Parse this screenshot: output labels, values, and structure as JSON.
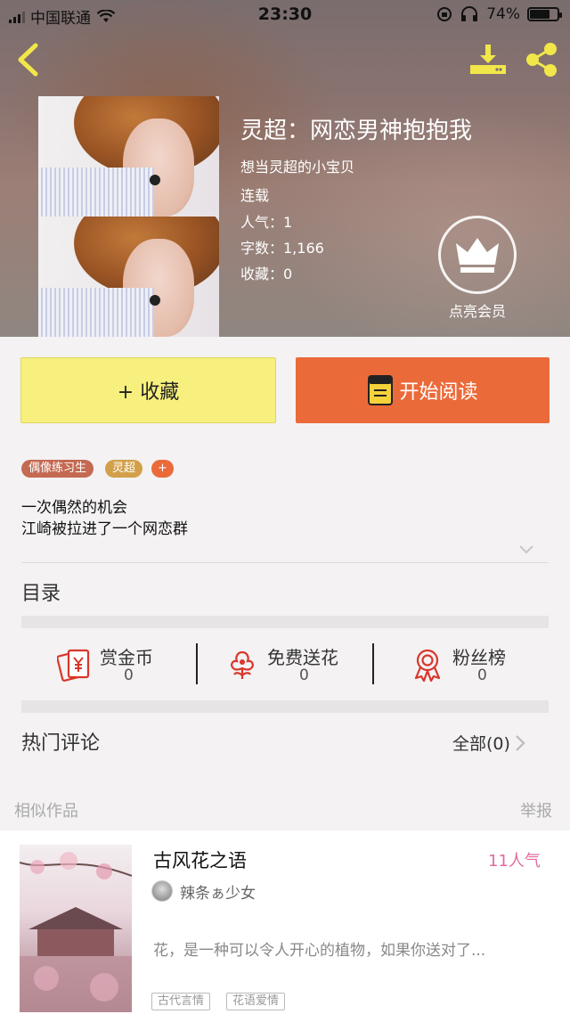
{
  "status_bar": {
    "carrier": "中国联通",
    "time": "23:30",
    "battery": "74%",
    "battery_level": 0.74
  },
  "book": {
    "title": "灵超：网恋男神抱抱我",
    "author": "想当灵超的小宝贝",
    "status": "连载",
    "popularity": "人气：1",
    "word_count": "字数：1,166",
    "favorites": "收藏：0",
    "vip_label": "点亮会员"
  },
  "actions": {
    "favorite": "+ 收藏",
    "read": "开始阅读"
  },
  "tags": [
    {
      "label": "偶像练习生",
      "color": "#c46a52"
    },
    {
      "label": "灵超",
      "color": "#d2a04a"
    },
    {
      "label": "+",
      "color": "#eb6a3a"
    }
  ],
  "synopsis": [
    "一次偶然的机会",
    "江崎被拉进了一个网恋群"
  ],
  "toc_title": "目录",
  "stats": [
    {
      "label": "赏金币",
      "value": "0",
      "icon": "red-envelope-icon"
    },
    {
      "label": "免费送花",
      "value": "0",
      "icon": "flower-icon"
    },
    {
      "label": "粉丝榜",
      "value": "0",
      "icon": "medal-icon"
    }
  ],
  "comments": {
    "title": "热门评论",
    "all_link": "全部(0)"
  },
  "similar": {
    "title": "相似作品",
    "report": "举报"
  },
  "recommendation": {
    "title": "古风花之语",
    "popularity": "11人气",
    "author": "辣条ぁ少女",
    "description": "花，是一种可以令人开心的植物，如果你送对了...",
    "tags": [
      "古代言情",
      "花语爱情"
    ]
  },
  "colors": {
    "accent": "#eb6a3a",
    "favorite_bg": "#f7f07e",
    "icon_yellow": "#f1e74a",
    "icon_red": "#d9362b",
    "pop_pink": "#e36aa0"
  }
}
